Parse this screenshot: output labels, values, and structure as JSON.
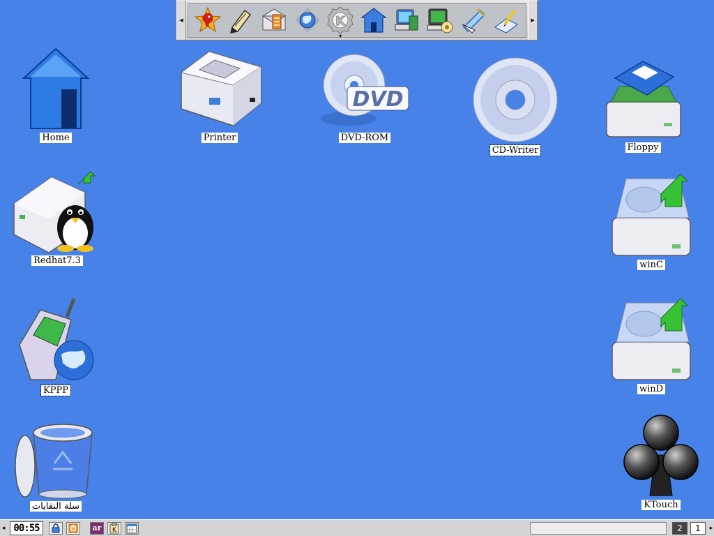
{
  "desktop": {
    "background": "#4682e8",
    "icons": [
      {
        "label": "Home",
        "icon": "home-folder-icon"
      },
      {
        "label": "Printer",
        "icon": "printer-icon"
      },
      {
        "label": "DVD-ROM",
        "icon": "dvd-icon"
      },
      {
        "label": "CD-Writer",
        "icon": "cd-icon"
      },
      {
        "label": "Floppy",
        "icon": "floppy-icon"
      },
      {
        "label": "Redhat7.3",
        "icon": "linux-drive-icon"
      },
      {
        "label": "winC",
        "icon": "hard-drive-icon"
      },
      {
        "label": "KPPP",
        "icon": "kppp-phone-icon"
      },
      {
        "label": "winD",
        "icon": "hard-drive-icon"
      },
      {
        "label": "سلة النفايات",
        "icon": "trash-icon"
      },
      {
        "label": "KTouch",
        "icon": "club-icon"
      }
    ]
  },
  "top_panel": {
    "left_arrow": "◂",
    "right_arrow": "▸",
    "launchers": [
      "mozilla-icon",
      "text-editor-icon",
      "mail-icon",
      "web-browser-icon",
      "kde-menu-icon",
      "home-icon",
      "system-monitor-icon",
      "terminal-icon",
      "control-center-icon",
      "writer-icon"
    ],
    "kmenu_arrow": "▾"
  },
  "taskbar": {
    "left_arrow": "◂",
    "clock": "00:55",
    "lock_icon": "lock-icon",
    "logout_icon": "logout-icon",
    "language": "ar",
    "desktops": [
      "2",
      "1"
    ],
    "right_arrow": "▸"
  }
}
